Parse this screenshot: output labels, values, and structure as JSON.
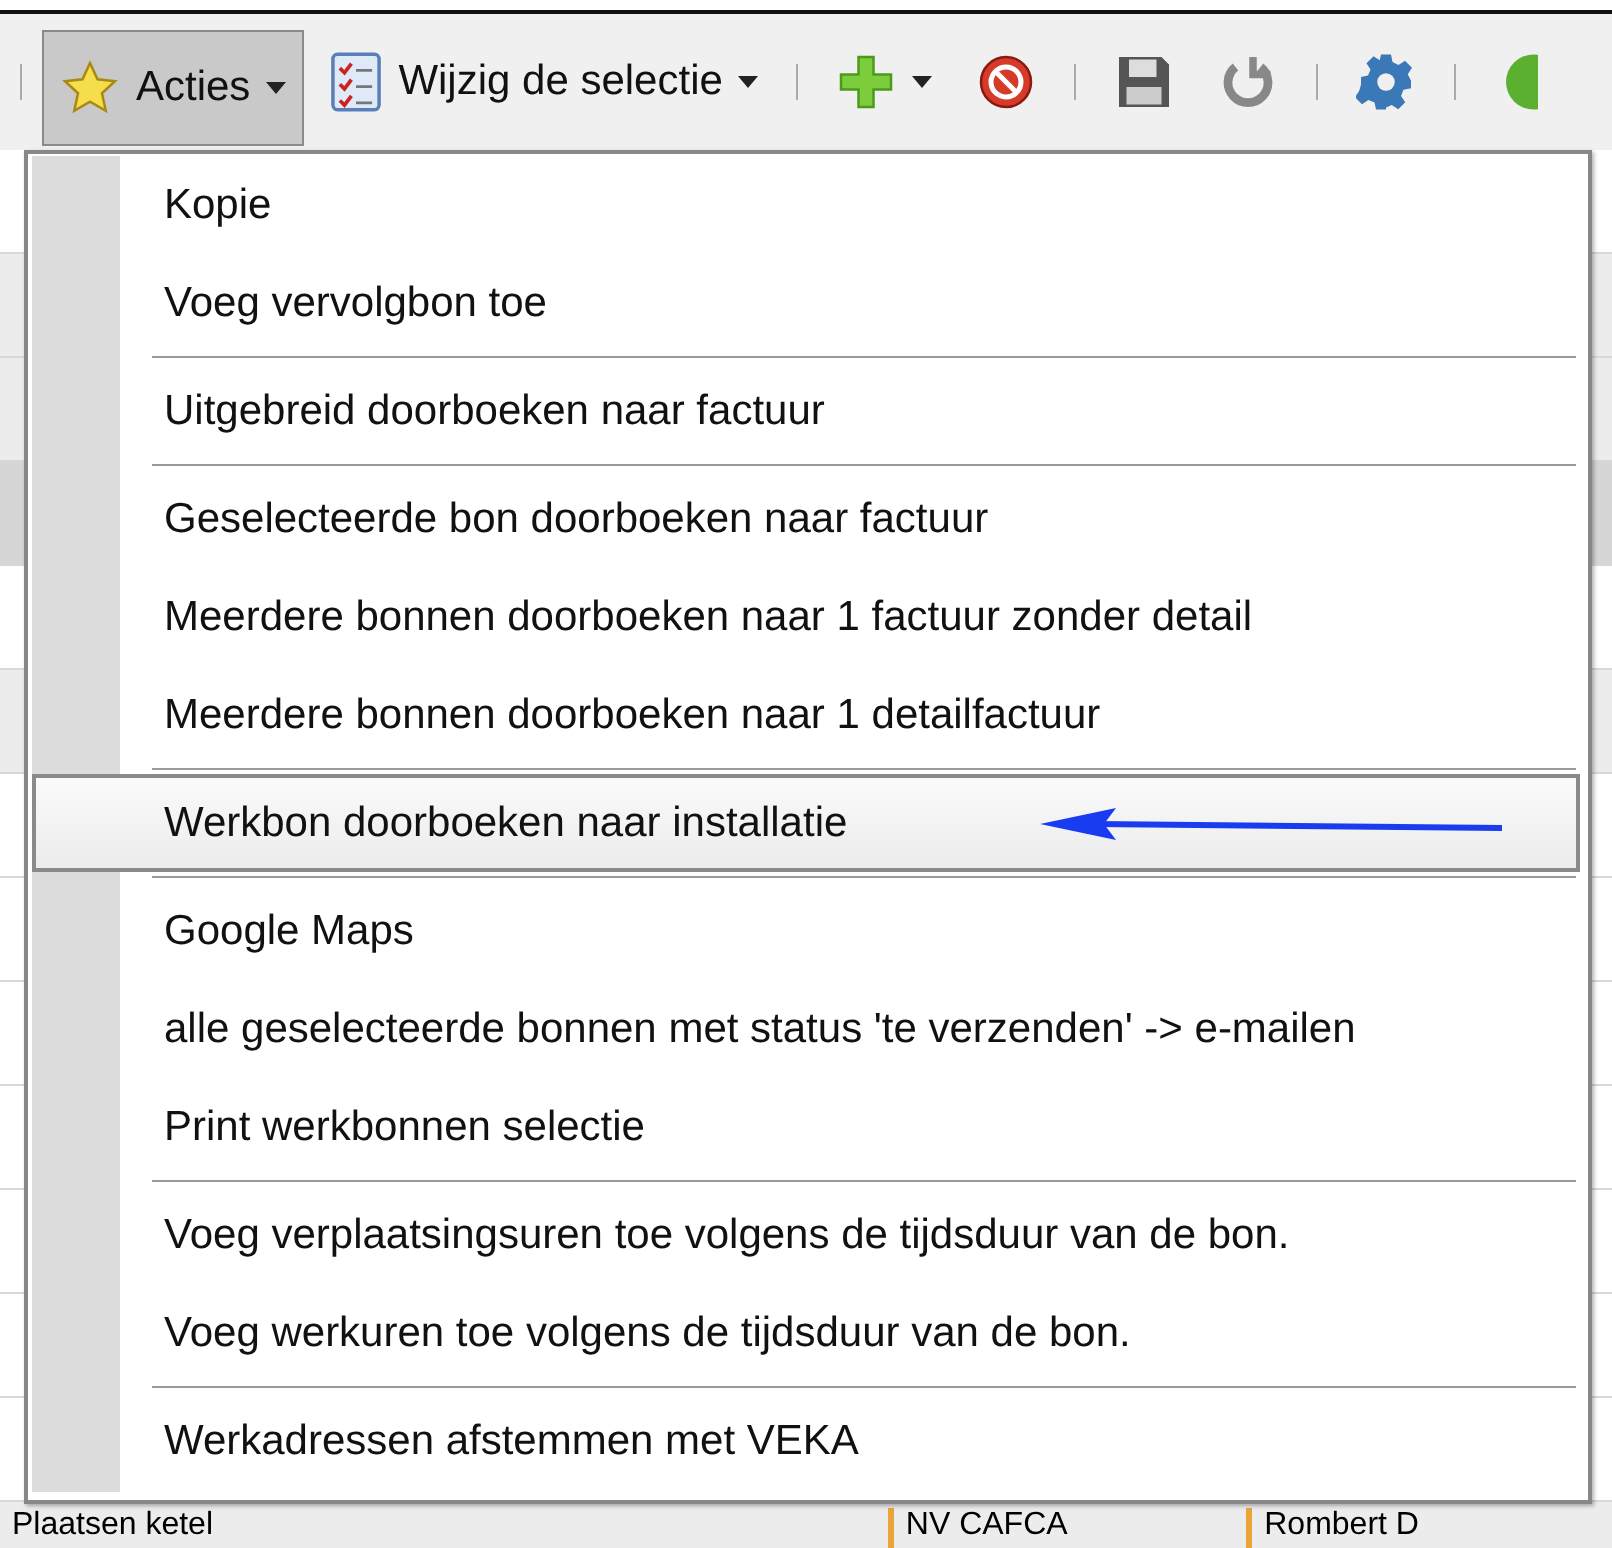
{
  "toolbar": [
    {
      "kind": "separator"
    },
    {
      "kind": "button",
      "label": "Acties",
      "dropdown": true,
      "pressed": true
    },
    {
      "kind": "button",
      "label": "Wijzig de selectie",
      "dropdown": true,
      "pressed": false
    },
    {
      "kind": "separator"
    },
    {
      "kind": "button",
      "dropdown": true,
      "pressed": false
    },
    {
      "kind": "button",
      "dropdown": false,
      "pressed": false
    },
    {
      "kind": "separator"
    },
    {
      "kind": "button",
      "dropdown": false,
      "pressed": false
    },
    {
      "kind": "button",
      "dropdown": false,
      "pressed": false
    },
    {
      "kind": "separator"
    },
    {
      "kind": "button",
      "dropdown": false,
      "pressed": false
    },
    {
      "kind": "separator"
    },
    {
      "kind": "button",
      "dropdown": false,
      "pressed": false
    }
  ],
  "grid": {
    "rows": [
      {
        "kind": "row"
      },
      {
        "kind": "shaded"
      },
      {
        "kind": "shaded"
      },
      {
        "kind": "header"
      },
      {
        "kind": "row"
      },
      {
        "kind": "shaded"
      },
      {
        "kind": "row"
      },
      {
        "kind": "row"
      },
      {
        "kind": "row"
      },
      {
        "kind": "row"
      },
      {
        "kind": "row"
      },
      {
        "kind": "row"
      },
      {
        "kind": "row"
      }
    ],
    "last_row": [
      "Plaatsen ketel",
      "NV CAFCA",
      "Rombert D"
    ]
  },
  "menu": {
    "groups": [
      [
        {
          "label": "Kopie",
          "selected": false
        },
        {
          "label": "Voeg vervolgbon toe",
          "selected": false
        }
      ],
      [
        {
          "label": "Uitgebreid doorboeken naar factuur",
          "selected": false
        }
      ],
      [
        {
          "label": "Geselecteerde bon doorboeken naar factuur",
          "selected": false
        },
        {
          "label": "Meerdere bonnen doorboeken naar 1 factuur zonder detail",
          "selected": false
        },
        {
          "label": "Meerdere bonnen doorboeken naar 1 detailfactuur",
          "selected": false
        }
      ],
      [
        {
          "label": "Werkbon doorboeken naar installatie",
          "selected": true
        }
      ],
      [
        {
          "label": "Google Maps",
          "selected": false
        },
        {
          "label": "alle geselecteerde bonnen met status 'te verzenden' -> e-mailen",
          "selected": false
        },
        {
          "label": "Print werkbonnen selectie",
          "selected": false
        }
      ],
      [
        {
          "label": "Voeg verplaatsingsuren toe volgens de tijdsduur van de bon.",
          "selected": false
        },
        {
          "label": "Voeg werkuren toe volgens de tijdsduur van de bon.",
          "selected": false
        }
      ],
      [
        {
          "label": "Werkadressen afstemmen met VEKA",
          "selected": false
        }
      ]
    ]
  }
}
